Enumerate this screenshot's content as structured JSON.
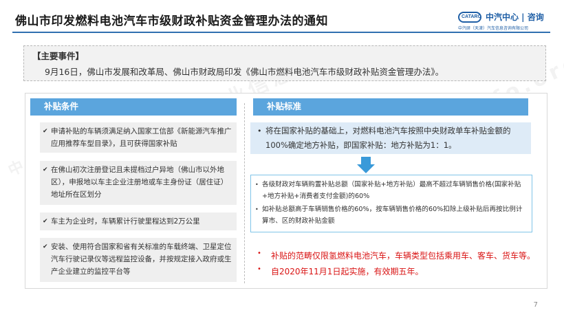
{
  "header": {
    "title": "佛山市印发燃料电池汽车市级财政补贴资金管理办法的通知",
    "logo_mark": "CATARC",
    "logo_name": "中汽中心 | 咨询",
    "logo_sub": "中汽研（天津）汽车信息咨询有限公司",
    "accent_color": "#2f6fb0"
  },
  "event": {
    "label": "【主要事件】",
    "text": "9月16日，佛山市发展和改革局、佛山市财政局印发《佛山市燃料电池汽车市级财政补贴资金管理办法》。"
  },
  "conditions": {
    "tab_label": "补贴条件",
    "check_glyph": "✔",
    "items": [
      "申请补贴的车辆须满足纳入国家工信部《新能源汽车推广应用推荐车型目录》，且可获得国家补贴",
      "在佛山初次注册登记且未提档过户异地（佛山市以外地区），申报地以车主企业注册地或车主身份证（居住证）地址所在区划分",
      "车主为企业时，车辆累计行驶里程达到2万公里",
      "安装、使用符合国家和省有关标准的车载终端、卫星定位汽车行驶记录仪等远程监控设备，并按规定接入政府或生产企业建立的监控平台等"
    ]
  },
  "standards": {
    "tab_label": "补贴标准",
    "tab_color": "#5ba5dd",
    "main_text": "将在国家补贴的基础上，对燃料电池汽车按照中央财政单车补贴金额的100%确定地方补贴，即国家补贴：地方补贴为1：1。",
    "formula": [
      "各级财政对车辆购置补贴总额（国家补贴+地方补贴）最高不超过车辆销售价格(国家补贴+地方补贴+消费者支付金额)的60%",
      "如补贴总额高于车辆销售价格的60%，按车辆销售价格的60%扣除上级补贴后再按比例计算市、区的财政补贴金额"
    ],
    "notes": [
      "补贴的范畴仅限氢燃料电池汽车，车辆类型包括乘用车、客车、货车等。",
      "自2020年11月1日起实施，有效期五年。"
    ],
    "note_color": "#d91414"
  },
  "page_number": "7",
  "watermark": {
    "phrase_1": "中国汽车工业信息网",
    "phrase_2": "www.autoinfo.org.cn",
    "phrase_3": "中国"
  }
}
